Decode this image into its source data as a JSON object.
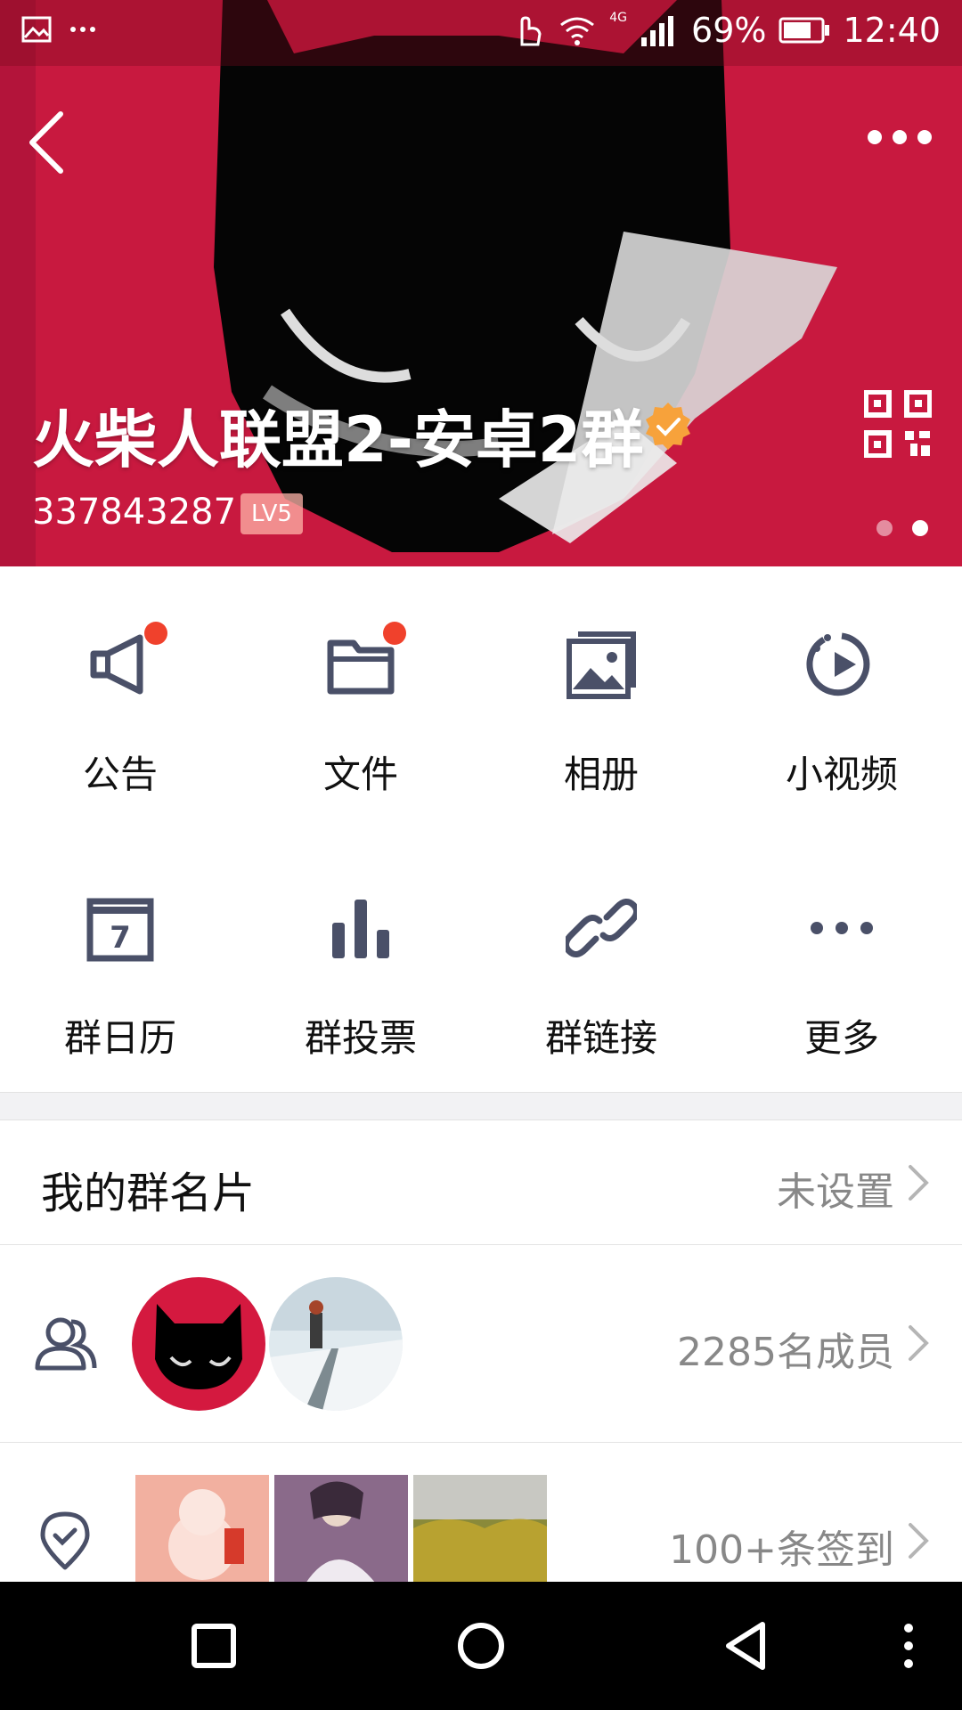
{
  "status_bar": {
    "notification_icons": [
      "image-icon",
      "more-dots-icon"
    ],
    "network": "4G",
    "battery": "69%",
    "time": "12:40"
  },
  "header": {
    "title": "火柴人联盟2-安卓2群",
    "group_id": "337843287",
    "level": "LV5",
    "pager_dots": 2,
    "pager_active_index": 1,
    "colors": {
      "background": "#c8193f",
      "badge": "#f7a23b"
    }
  },
  "grid": {
    "items": [
      {
        "label": "公告",
        "icon": "megaphone-icon",
        "badge": true
      },
      {
        "label": "文件",
        "icon": "folder-icon",
        "badge": true
      },
      {
        "label": "相册",
        "icon": "album-icon",
        "badge": false
      },
      {
        "label": "小视频",
        "icon": "video-icon",
        "badge": false
      },
      {
        "label": "群日历",
        "icon": "calendar-icon",
        "badge": false,
        "calendar_day": "7"
      },
      {
        "label": "群投票",
        "icon": "bar-chart-icon",
        "badge": false
      },
      {
        "label": "群链接",
        "icon": "link-icon",
        "badge": false
      },
      {
        "label": "更多",
        "icon": "more-icon",
        "badge": false
      }
    ]
  },
  "card_row": {
    "title": "我的群名片",
    "value": "未设置"
  },
  "members_row": {
    "value": "2285名成员"
  },
  "checkin_row": {
    "value": "100+条签到"
  }
}
